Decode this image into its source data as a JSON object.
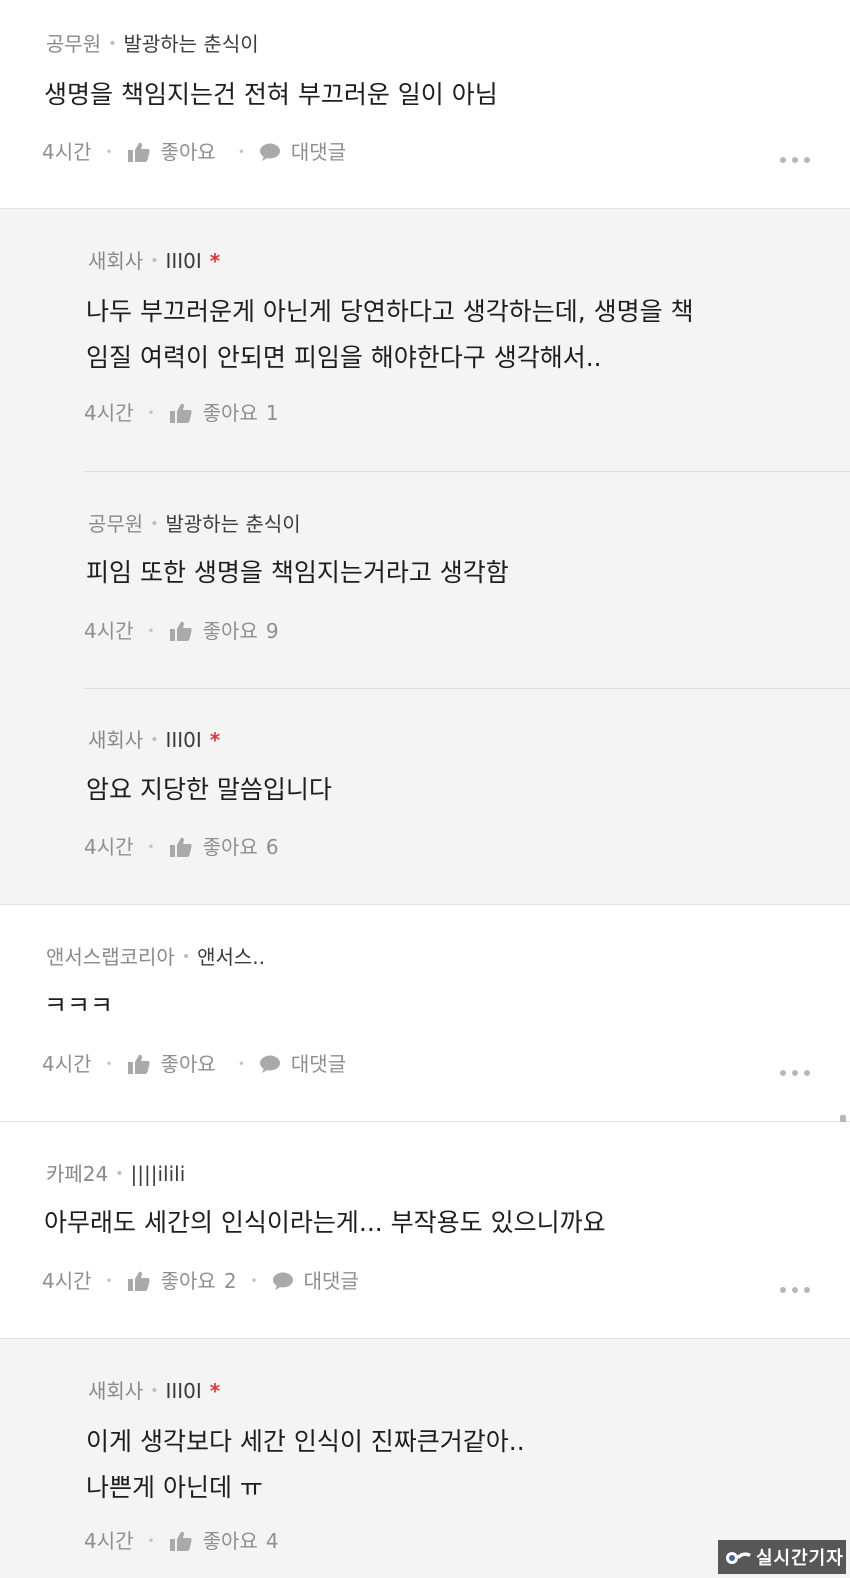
{
  "comments": [
    {
      "company": "공무원",
      "nick": "발광하는 춘식이",
      "text": "생명을 책임지는건 전혀 부끄러운 일이 아님",
      "time": "4시간",
      "like_label": "좋아요",
      "like_count": "",
      "reply_label": "대댓글"
    },
    {
      "company": "앤서스랩코리아",
      "nick": "앤서스..",
      "text": "ㅋㅋㅋ",
      "time": "4시간",
      "like_label": "좋아요",
      "like_count": "",
      "reply_label": "대댓글"
    },
    {
      "company": "카페24",
      "nick": "||||ilili",
      "text": "아무래도 세간의 인식이라는게... 부작용도 있으니까요",
      "time": "4시간",
      "like_label": "좋아요",
      "like_count": "2",
      "reply_label": "대댓글"
    }
  ],
  "replies_group1": [
    {
      "company": "새회사",
      "nick": "III0I",
      "star": "*",
      "text": "나두 부끄러운게 아닌게 당연하다고 생각하는데, 생명을 책\n임질 여력이 안되면 피임을 해야한다구 생각해서..",
      "time": "4시간",
      "like_label": "좋아요",
      "like_count": "1"
    },
    {
      "company": "공무원",
      "nick": "발광하는 춘식이",
      "star": "",
      "text": "피임 또한 생명을 책임지는거라고 생각함",
      "time": "4시간",
      "like_label": "좋아요",
      "like_count": "9"
    },
    {
      "company": "새회사",
      "nick": "III0I",
      "star": "*",
      "text": "암요 지당한 말씀입니다",
      "time": "4시간",
      "like_label": "좋아요",
      "like_count": "6"
    }
  ],
  "replies_group2": [
    {
      "company": "새회사",
      "nick": "III0I",
      "star": "*",
      "text": "이게 생각보다 세간 인식이 진짜큰거같아..\n나쁜게 아닌데 ㅠ",
      "time": "4시간",
      "like_label": "좋아요",
      "like_count": "4"
    }
  ],
  "watermark": {
    "text": "실시간기자"
  },
  "colors": {
    "reply_bg": "#f4f4f4",
    "star": "#e0353e",
    "meta": "#8f8f8f"
  },
  "icons": {
    "like": "thumbs-up-icon",
    "reply": "speech-bubble-icon",
    "more": "more-dots-icon"
  }
}
